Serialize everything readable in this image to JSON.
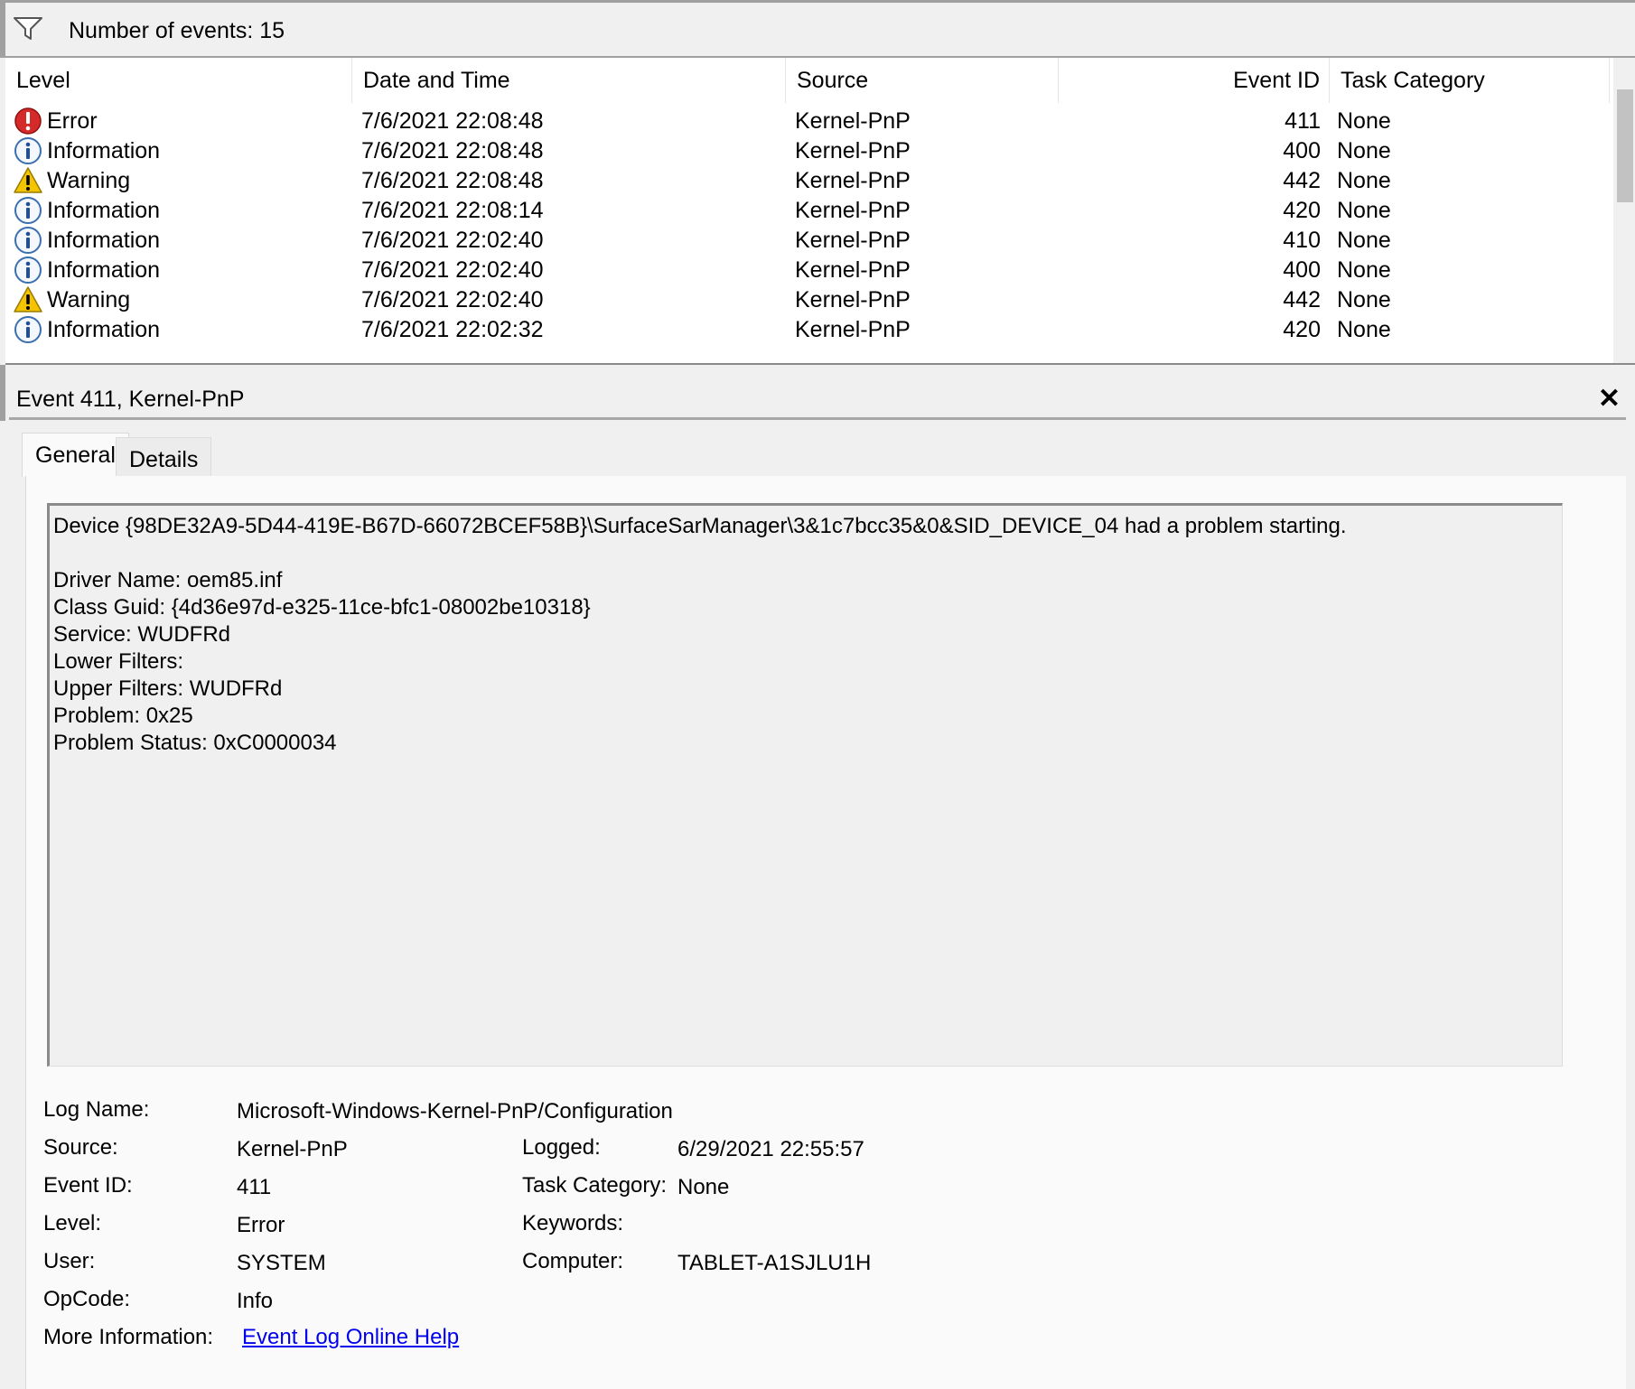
{
  "filter_bar": {
    "event_count_text": "Number of events: 15"
  },
  "columns": {
    "level": "Level",
    "date_time": "Date and Time",
    "source": "Source",
    "event_id": "Event ID",
    "task_category": "Task Category"
  },
  "events": [
    {
      "icon": "error-icon",
      "level": "Error",
      "date_time": "7/6/2021 22:08:48",
      "source": "Kernel-PnP",
      "event_id": "411",
      "task_category": "None"
    },
    {
      "icon": "information-icon",
      "level": "Information",
      "date_time": "7/6/2021 22:08:48",
      "source": "Kernel-PnP",
      "event_id": "400",
      "task_category": "None"
    },
    {
      "icon": "warning-icon",
      "level": "Warning",
      "date_time": "7/6/2021 22:08:48",
      "source": "Kernel-PnP",
      "event_id": "442",
      "task_category": "None"
    },
    {
      "icon": "information-icon",
      "level": "Information",
      "date_time": "7/6/2021 22:08:14",
      "source": "Kernel-PnP",
      "event_id": "420",
      "task_category": "None"
    },
    {
      "icon": "information-icon",
      "level": "Information",
      "date_time": "7/6/2021 22:02:40",
      "source": "Kernel-PnP",
      "event_id": "410",
      "task_category": "None"
    },
    {
      "icon": "information-icon",
      "level": "Information",
      "date_time": "7/6/2021 22:02:40",
      "source": "Kernel-PnP",
      "event_id": "400",
      "task_category": "None"
    },
    {
      "icon": "warning-icon",
      "level": "Warning",
      "date_time": "7/6/2021 22:02:40",
      "source": "Kernel-PnP",
      "event_id": "442",
      "task_category": "None"
    },
    {
      "icon": "information-icon",
      "level": "Information",
      "date_time": "7/6/2021 22:02:32",
      "source": "Kernel-PnP",
      "event_id": "420",
      "task_category": "None"
    }
  ],
  "detail": {
    "title": "Event 411, Kernel-PnP",
    "close_label": "✕",
    "tabs": {
      "general": "General",
      "details": "Details"
    },
    "description_lines": [
      "Device {98DE32A9-5D44-419E-B67D-66072BCEF58B}\\SurfaceSarManager\\3&1c7bcc35&0&SID_DEVICE_04 had a problem starting.",
      "",
      "Driver Name: oem85.inf",
      "Class Guid: {4d36e97d-e325-11ce-bfc1-08002be10318}",
      "Service: WUDFRd",
      "Lower Filters: ",
      "Upper Filters: WUDFRd",
      "Problem: 0x25",
      "Problem Status: 0xC0000034"
    ],
    "fields": {
      "log_name": {
        "label": "Log Name:",
        "value": "Microsoft-Windows-Kernel-PnP/Configuration"
      },
      "source": {
        "label": "Source:",
        "value": "Kernel-PnP"
      },
      "logged": {
        "label": "Logged:",
        "value": "6/29/2021 22:55:57"
      },
      "event_id": {
        "label": "Event ID:",
        "value": "411"
      },
      "task_category": {
        "label": "Task Category:",
        "value": "None"
      },
      "level": {
        "label": "Level:",
        "value": "Error"
      },
      "keywords": {
        "label": "Keywords:",
        "value": ""
      },
      "user": {
        "label": "User:",
        "value": "SYSTEM"
      },
      "computer": {
        "label": "Computer:",
        "value": "TABLET-A1SJLU1H"
      },
      "opcode": {
        "label": "OpCode:",
        "value": "Info"
      },
      "more_info": {
        "label": "More Information:",
        "link_text": "Event Log Online Help"
      }
    }
  },
  "colors": {
    "error": "#d42a2a",
    "warning": "#f5c400",
    "information": "#3a6fb0",
    "link": "#0000ee"
  }
}
